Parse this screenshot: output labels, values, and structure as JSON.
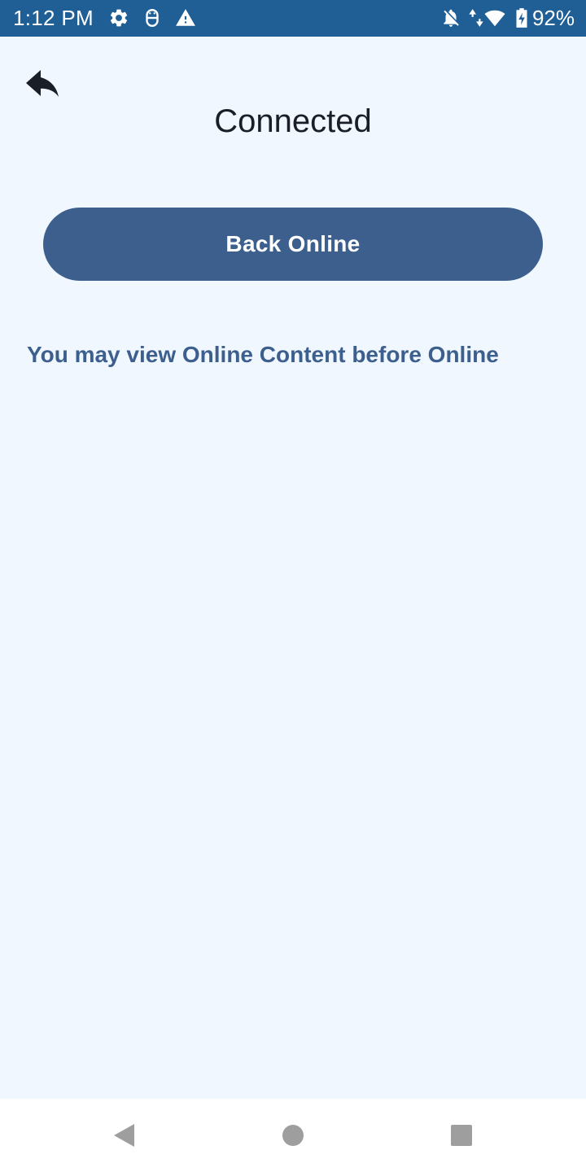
{
  "status_bar": {
    "time": "1:12 PM",
    "battery_percent": "92%",
    "left_icons": [
      "gear-icon",
      "usb-debug-icon",
      "warning-icon"
    ],
    "right_icons": [
      "notifications-off-icon",
      "data-arrows-icon",
      "wifi-icon",
      "battery-charging-icon"
    ]
  },
  "header": {
    "title": "Connected",
    "back_icon": "reply-arrow-icon"
  },
  "main": {
    "button_label": "Back Online",
    "info_text": "You may view Online Content before Online"
  },
  "nav_bar": {
    "icons": [
      "nav-back-icon",
      "nav-home-icon",
      "nav-recents-icon"
    ]
  },
  "colors": {
    "status_bar": "#1f5f96",
    "background": "#f1f7fe",
    "accent": "#3d5f8e",
    "title_text": "#1a1e26"
  }
}
